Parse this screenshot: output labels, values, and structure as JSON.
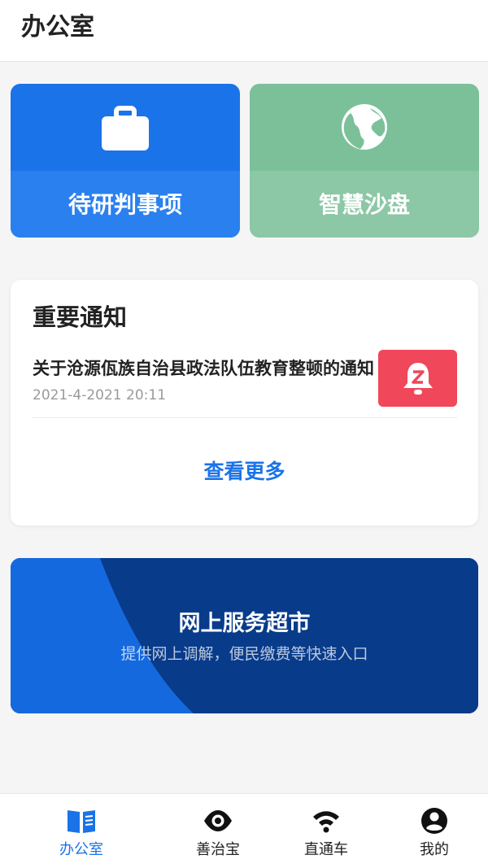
{
  "header": {
    "title": "办公室"
  },
  "tiles": [
    {
      "label": "待研判事项",
      "icon": "briefcase-icon",
      "color": "#1a73e8"
    },
    {
      "label": "智慧沙盘",
      "icon": "globe-icon",
      "color": "#7cc09a"
    }
  ],
  "notice": {
    "title": "重要通知",
    "items": [
      {
        "text": "关于沧源佤族自治县政法队伍教育整顿的通知",
        "time": "2021-4-2021 20:11",
        "icon": "bell-icon"
      }
    ],
    "more": "查看更多"
  },
  "banner": {
    "title": "网上服务超市",
    "subtitle": "提供网上调解，便民缴费等快速入口"
  },
  "nav": {
    "items": [
      {
        "label": "办公室",
        "icon": "book-icon",
        "active": true
      },
      {
        "label": "善治宝",
        "icon": "eye-icon",
        "active": false
      },
      {
        "label": "直通车",
        "icon": "signal-icon",
        "active": false
      },
      {
        "label": "我的",
        "icon": "user-icon",
        "active": false
      }
    ]
  },
  "colors": {
    "accent": "#1a73e8",
    "alert": "#f0475a",
    "banner_dark": "#083b8a"
  }
}
